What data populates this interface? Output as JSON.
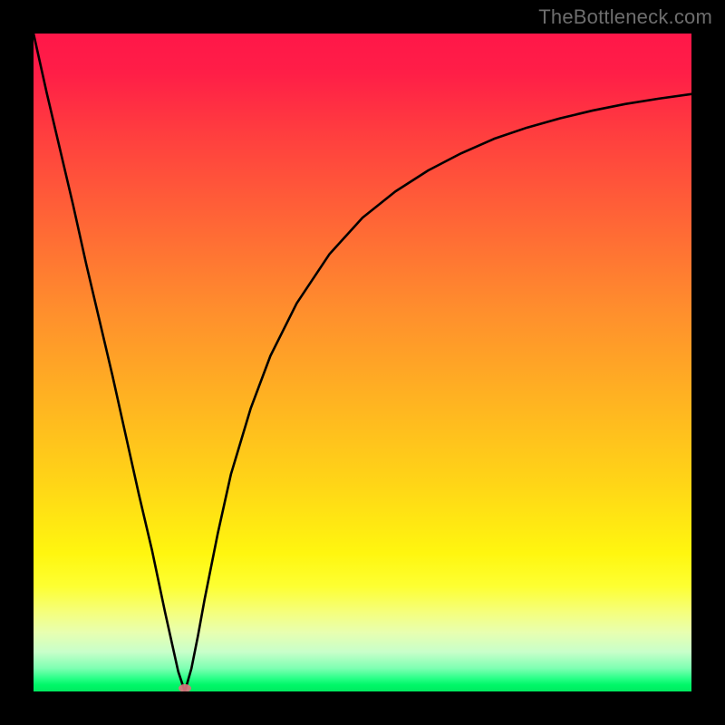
{
  "watermark": "TheBottleneck.com",
  "chart_data": {
    "type": "line",
    "title": "",
    "xlabel": "",
    "ylabel": "",
    "xlim": [
      0,
      100
    ],
    "ylim": [
      0,
      100
    ],
    "grid": false,
    "legend": false,
    "background": "rainbow-gradient",
    "notch_x": 23,
    "marker": {
      "x": 23,
      "y": 0.5,
      "color": "#d9757f"
    },
    "series": [
      {
        "name": "curve",
        "color": "#000000",
        "x": [
          0,
          2,
          4,
          6,
          8,
          10,
          12,
          14,
          16,
          18,
          20,
          21,
          22,
          23,
          24,
          25,
          26,
          28,
          30,
          33,
          36,
          40,
          45,
          50,
          55,
          60,
          65,
          70,
          75,
          80,
          85,
          90,
          95,
          100
        ],
        "y": [
          100,
          91,
          82.5,
          74,
          65,
          56.5,
          48,
          39,
          30,
          21.5,
          12,
          7.5,
          3,
          0,
          3.5,
          8.5,
          14,
          24,
          33,
          43,
          51,
          59,
          66.5,
          72,
          76,
          79.2,
          81.8,
          84,
          85.7,
          87.1,
          88.3,
          89.3,
          90.1,
          90.8
        ]
      }
    ]
  }
}
